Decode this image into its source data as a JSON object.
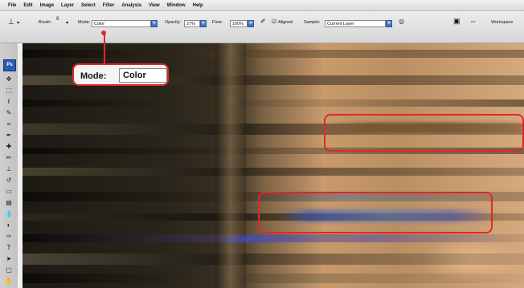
{
  "menu": [
    "File",
    "Edit",
    "Image",
    "Layer",
    "Select",
    "Filter",
    "Analysis",
    "View",
    "Window",
    "Help"
  ],
  "options": {
    "brush_label": "Brush:",
    "brush_size": "9",
    "mode_label": "Mode:",
    "mode_value": "Color",
    "opacity_label": "Opacity:",
    "opacity_value": "27%",
    "flow_label": "Flow:",
    "flow_value": "100%",
    "aligned_label": "Aligned",
    "sample_label": "Sample:",
    "sample_value": "Current Layer",
    "workspace_label": "Workspace"
  },
  "toolbox": {
    "ps_label": "Ps"
  },
  "callout": {
    "mode_label": "Mode:",
    "mode_value": "Color"
  },
  "colors": {
    "callout_red": "#e2262b",
    "ps_blue": "#2b5db0"
  }
}
